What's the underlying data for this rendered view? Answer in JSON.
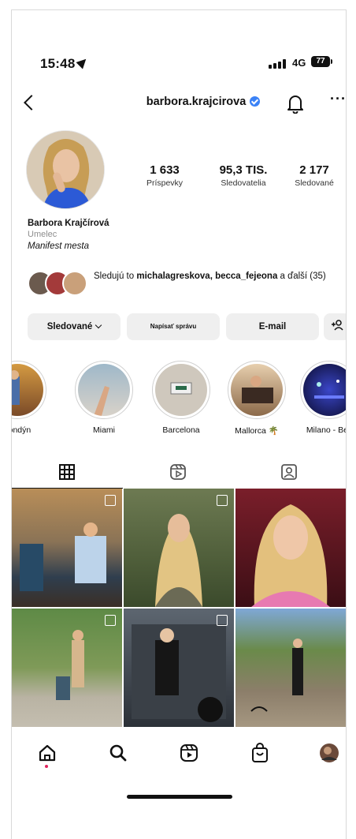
{
  "status_bar": {
    "time": "15:48",
    "network": "4G",
    "battery": "77"
  },
  "header": {
    "username": "barbora.krajcirova",
    "verified": true
  },
  "stats": [
    {
      "value": "1 633",
      "label": "Príspevky"
    },
    {
      "value": "95,3 TIS.",
      "label": "Sledovatelia"
    },
    {
      "value": "2 177",
      "label": "Sledované"
    }
  ],
  "bio": {
    "name": "Barbora Krajčírová",
    "category": "Umelec",
    "quote": "Manifest mesta"
  },
  "followed_by": {
    "prefix": "Sledujú to ",
    "names": "michalagreskova, becca_fejeona",
    "suffix": " a ďalší (35)"
  },
  "actions": {
    "following": "Sledované",
    "message": "Napísať správu",
    "email": "E-mail"
  },
  "highlights": [
    {
      "label": "Londýn"
    },
    {
      "label": "Miami"
    },
    {
      "label": "Barcelona"
    },
    {
      "label": "Mallorca 🌴"
    },
    {
      "label": "Milano - Bey"
    }
  ],
  "colors": {
    "accent": "#3b82f6",
    "button_bg": "#efefef",
    "notification_dot": "#e0245e"
  },
  "icons": [
    "back-icon",
    "verified-icon",
    "bell-icon",
    "more-icon",
    "grid-icon",
    "reels-icon",
    "tagged-icon",
    "home-icon",
    "search-icon",
    "shop-icon",
    "add-person-icon"
  ]
}
